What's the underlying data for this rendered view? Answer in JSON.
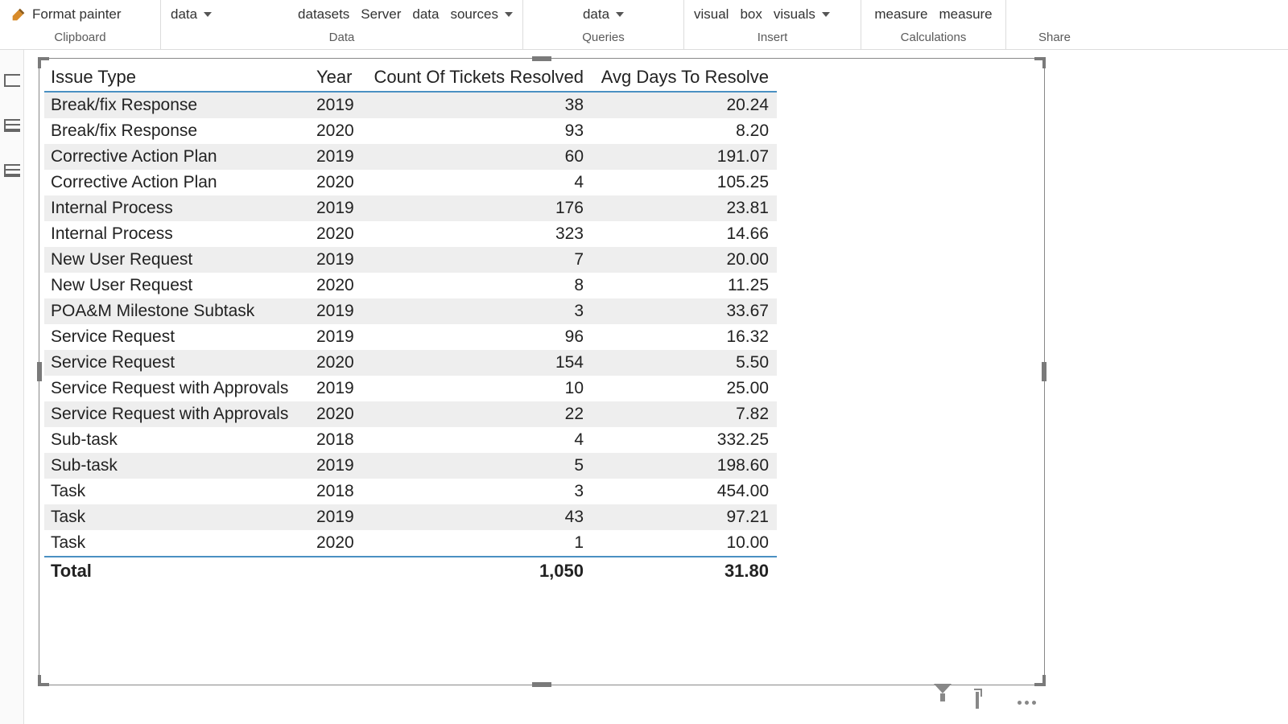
{
  "ribbon": {
    "clipboard": {
      "label": "Clipboard",
      "format_painter": "Format painter"
    },
    "data": {
      "label": "Data",
      "get_data": "data",
      "datasets": "datasets",
      "server": "Server",
      "data2": "data",
      "sources": "sources"
    },
    "queries": {
      "label": "Queries",
      "transform": "data"
    },
    "insert": {
      "label": "Insert",
      "visual": "visual",
      "box": "box",
      "visuals": "visuals"
    },
    "calculations": {
      "label": "Calculations",
      "measure1": "measure",
      "measure2": "measure"
    },
    "share": {
      "label": "Share"
    }
  },
  "chart_data": {
    "type": "table",
    "columns": [
      "Issue Type",
      "Year",
      "Count Of Tickets Resolved",
      "Avg Days To Resolve"
    ],
    "rows": [
      {
        "issue": "Break/fix Response",
        "year": "2019",
        "count": "38",
        "avg": "20.24"
      },
      {
        "issue": "Break/fix Response",
        "year": "2020",
        "count": "93",
        "avg": "8.20"
      },
      {
        "issue": "Corrective Action Plan",
        "year": "2019",
        "count": "60",
        "avg": "191.07"
      },
      {
        "issue": "Corrective Action Plan",
        "year": "2020",
        "count": "4",
        "avg": "105.25"
      },
      {
        "issue": "Internal Process",
        "year": "2019",
        "count": "176",
        "avg": "23.81"
      },
      {
        "issue": "Internal Process",
        "year": "2020",
        "count": "323",
        "avg": "14.66"
      },
      {
        "issue": "New User Request",
        "year": "2019",
        "count": "7",
        "avg": "20.00"
      },
      {
        "issue": "New User Request",
        "year": "2020",
        "count": "8",
        "avg": "11.25"
      },
      {
        "issue": "POA&M Milestone Subtask",
        "year": "2019",
        "count": "3",
        "avg": "33.67"
      },
      {
        "issue": "Service Request",
        "year": "2019",
        "count": "96",
        "avg": "16.32"
      },
      {
        "issue": "Service Request",
        "year": "2020",
        "count": "154",
        "avg": "5.50"
      },
      {
        "issue": "Service Request with Approvals",
        "year": "2019",
        "count": "10",
        "avg": "25.00"
      },
      {
        "issue": "Service Request with Approvals",
        "year": "2020",
        "count": "22",
        "avg": "7.82"
      },
      {
        "issue": "Sub-task",
        "year": "2018",
        "count": "4",
        "avg": "332.25"
      },
      {
        "issue": "Sub-task",
        "year": "2019",
        "count": "5",
        "avg": "198.60"
      },
      {
        "issue": "Task",
        "year": "2018",
        "count": "3",
        "avg": "454.00"
      },
      {
        "issue": "Task",
        "year": "2019",
        "count": "43",
        "avg": "97.21"
      },
      {
        "issue": "Task",
        "year": "2020",
        "count": "1",
        "avg": "10.00"
      }
    ],
    "total": {
      "label": "Total",
      "count": "1,050",
      "avg": "31.80"
    }
  }
}
